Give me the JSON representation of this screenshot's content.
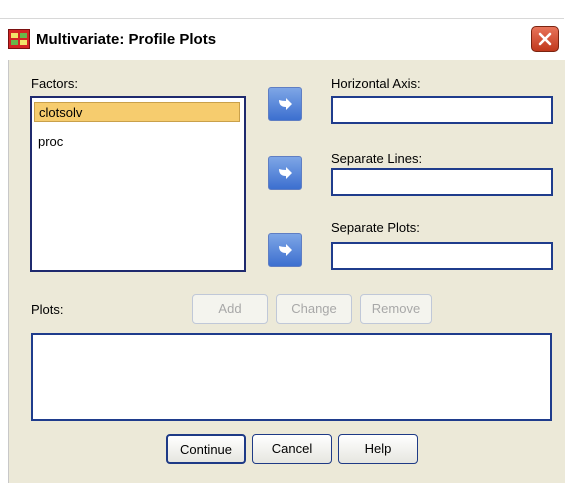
{
  "window": {
    "title": "Multivariate: Profile Plots"
  },
  "factors": {
    "label": "Factors:",
    "items": [
      "clotsolv",
      "proc"
    ],
    "selected_index": 0
  },
  "axes": {
    "horizontal_label": "Horizontal Axis:",
    "separate_lines_label": "Separate Lines:",
    "separate_plots_label": "Separate Plots:"
  },
  "plots": {
    "label": "Plots:",
    "add": "Add",
    "change": "Change",
    "remove": "Remove"
  },
  "footer": {
    "continue": "Continue",
    "cancel": "Cancel",
    "help": "Help"
  },
  "colors": {
    "panel": "#ece9d8",
    "selection": "#f6cc6e",
    "close_button": "#c0381c",
    "arrow_button": "#3c6fcf"
  }
}
